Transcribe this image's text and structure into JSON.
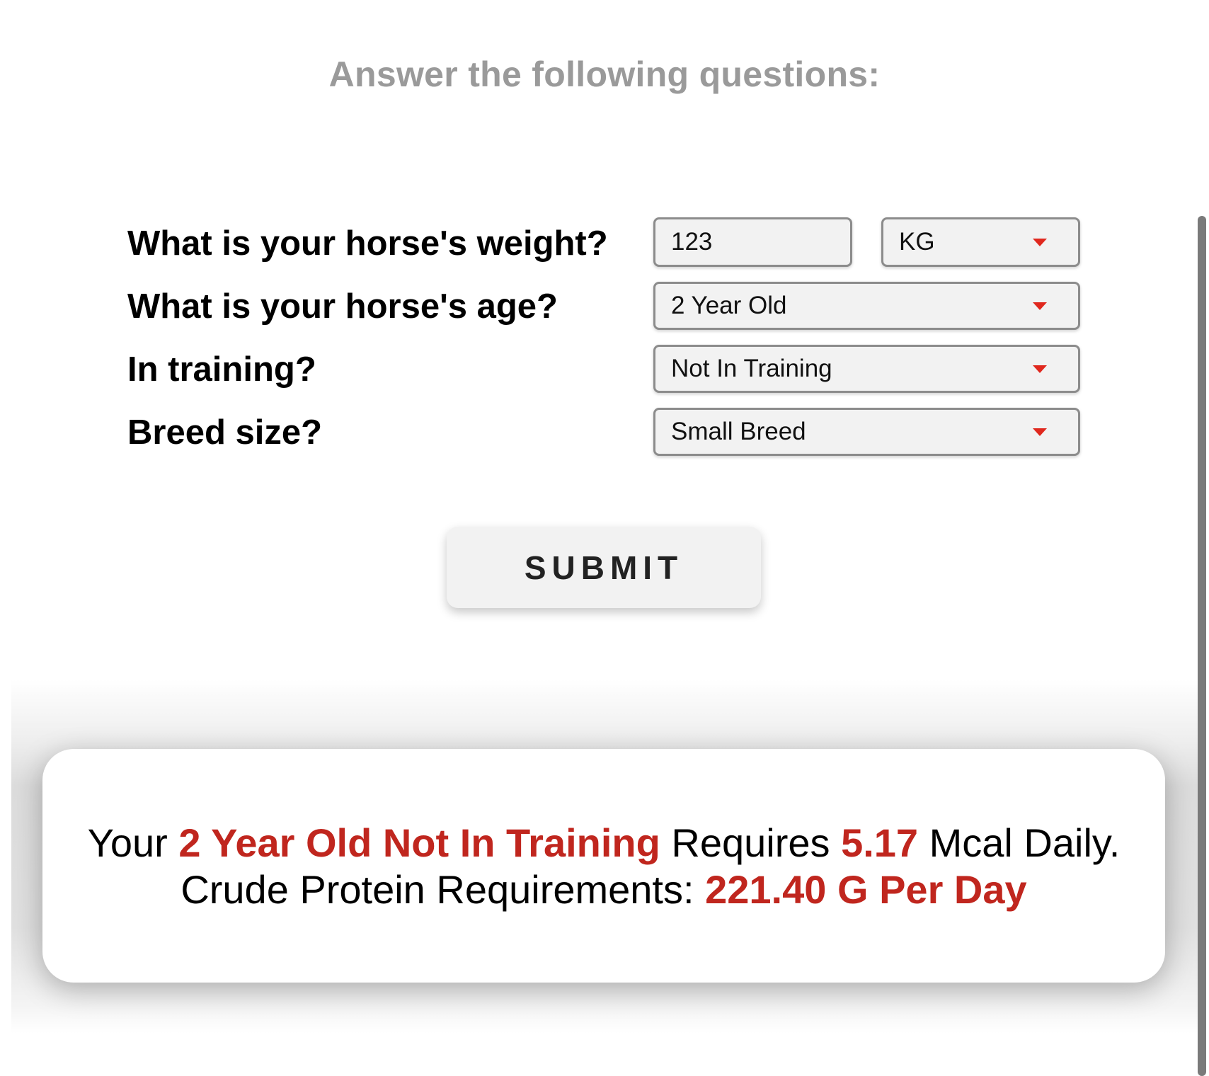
{
  "heading": "Answer the following questions:",
  "form": {
    "weight": {
      "label": "What is your horse's weight?",
      "value": "123",
      "unit": "KG"
    },
    "age": {
      "label": "What is your horse's age?",
      "value": "2 Year Old"
    },
    "training": {
      "label": "In training?",
      "value": "Not In Training"
    },
    "breed": {
      "label": "Breed size?",
      "value": "Small Breed"
    },
    "submit_label": "SUBMIT"
  },
  "result": {
    "line1": {
      "prefix": "Your",
      "horse": "2 Year Old Not In Training",
      "mid": "Requires",
      "mcal": "5.17",
      "suffix": "Mcal Daily."
    },
    "line2": {
      "prefix": "Crude Protein Requirements:",
      "protein": "221.40 G Per Day"
    }
  },
  "colors": {
    "accent": "#c0261e",
    "caret": "#e0281e",
    "heading": "#9a9a9a",
    "field_bg": "#f2f2f2",
    "field_border": "#8c8c8c"
  },
  "icons": [
    "dropdown-caret-icon"
  ]
}
